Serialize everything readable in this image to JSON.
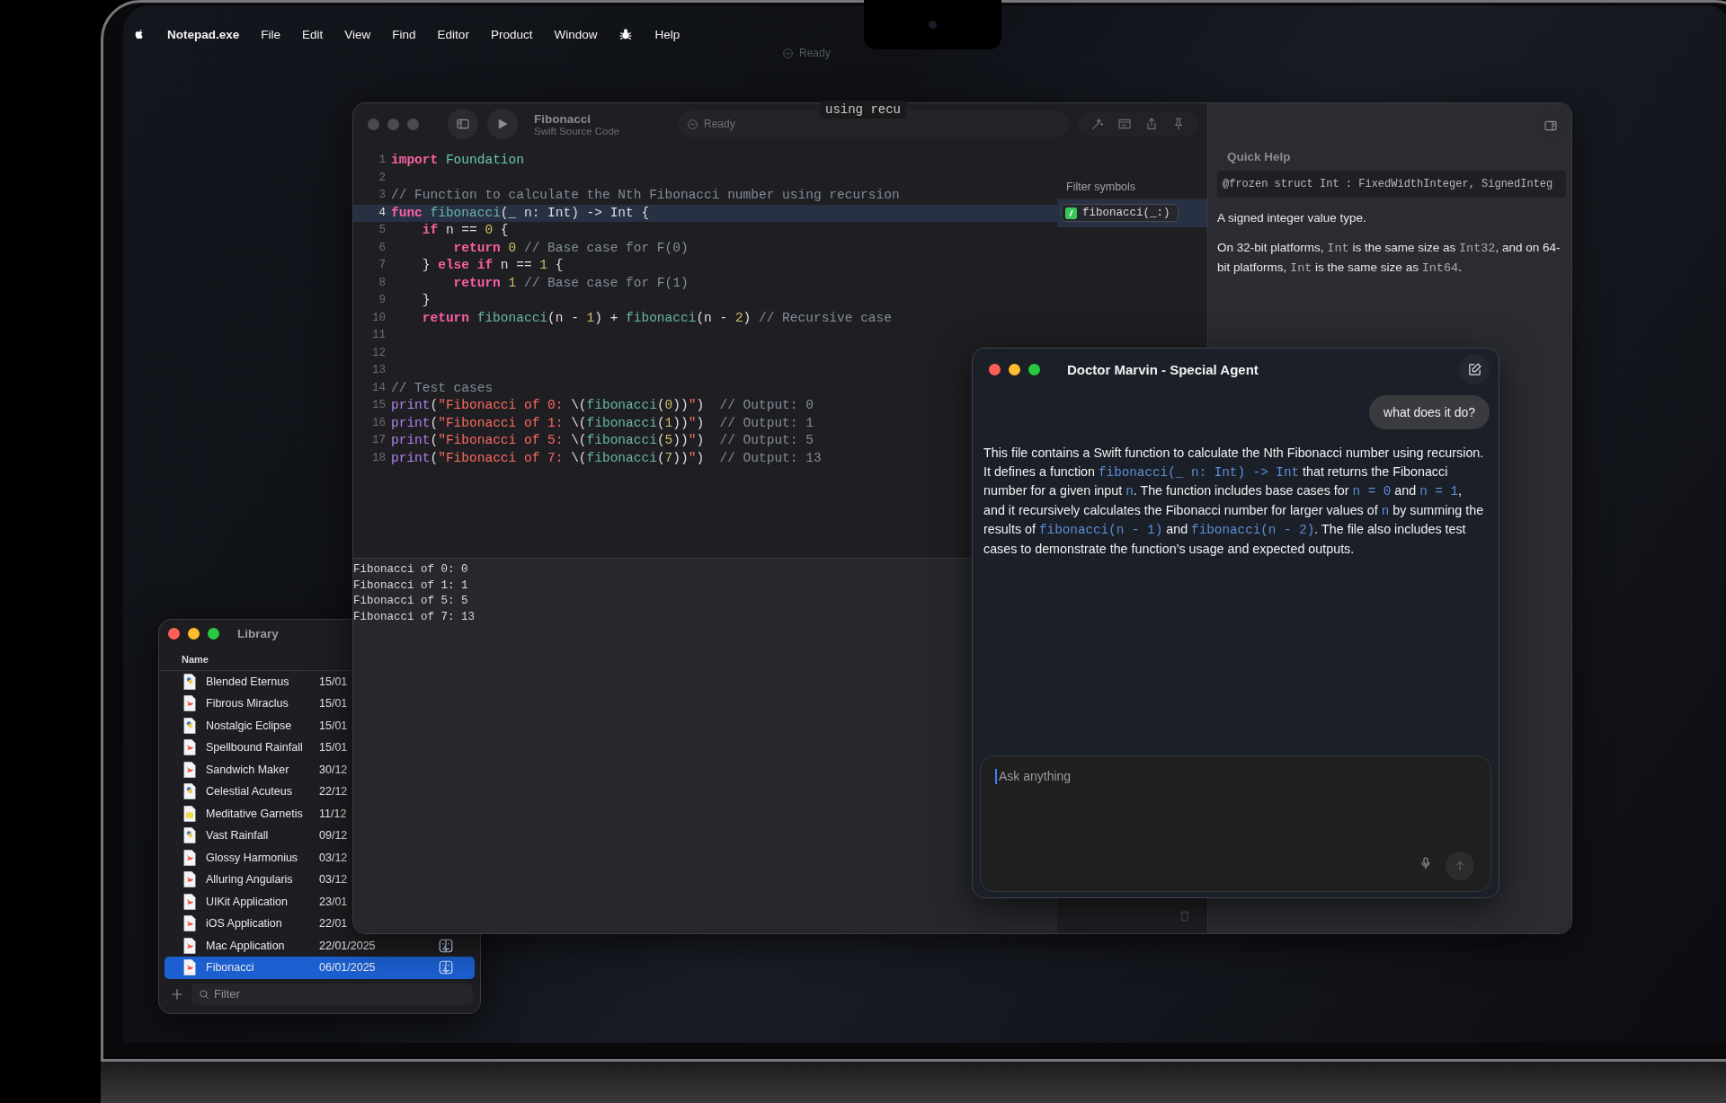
{
  "menu_bar": {
    "app_name": "Notepad.exe",
    "items": [
      "File",
      "Edit",
      "View",
      "Find",
      "Editor",
      "Product",
      "Window"
    ],
    "help": "Help"
  },
  "desktop_status": {
    "status": "Ready"
  },
  "editor_window": {
    "active": false,
    "title": "Fibonacci",
    "subtitle": "Swift Source Code",
    "status": "Ready",
    "tooltip": "using recu",
    "lines": [
      {
        "number": "1",
        "highlighted": false,
        "tokens": [
          {
            "kind": "keyword",
            "text": "import"
          },
          {
            "kind": "type",
            "text": " Foundation"
          }
        ]
      },
      {
        "number": "2",
        "highlighted": false
      },
      {
        "number": "3",
        "highlighted": false,
        "tokens": [
          {
            "kind": "comment",
            "text": "// Function to calculate the Nth Fibonacci number using recursion"
          }
        ]
      },
      {
        "number": "4",
        "highlighted": true,
        "tokens": [
          {
            "kind": "keyword",
            "text": "func"
          },
          {
            "kind": "func",
            "text": " fibonacci"
          },
          {
            "kind": "plain",
            "text": "(_ n: Int) -> Int {"
          }
        ]
      },
      {
        "number": "5",
        "highlighted": false,
        "tokens": [
          {
            "kind": "keyword",
            "text": "    if"
          },
          {
            "kind": "plain",
            "text": " n == "
          },
          {
            "kind": "number",
            "text": "0"
          },
          {
            "kind": "plain",
            "text": " {"
          }
        ]
      },
      {
        "number": "6",
        "highlighted": false,
        "tokens": [
          {
            "kind": "keyword",
            "text": "        return"
          },
          {
            "kind": "number",
            "text": " 0"
          },
          {
            "kind": "comment",
            "text": " // Base case for F(0)"
          }
        ]
      },
      {
        "number": "7",
        "highlighted": false,
        "tokens": [
          {
            "kind": "plain",
            "text": "    } "
          },
          {
            "kind": "keyword",
            "text": "else if"
          },
          {
            "kind": "plain",
            "text": " n == "
          },
          {
            "kind": "number",
            "text": "1"
          },
          {
            "kind": "plain",
            "text": " {"
          }
        ]
      },
      {
        "number": "8",
        "highlighted": false,
        "tokens": [
          {
            "kind": "keyword",
            "text": "        return"
          },
          {
            "kind": "number",
            "text": " 1"
          },
          {
            "kind": "comment",
            "text": " // Base case for F(1)"
          }
        ]
      },
      {
        "number": "9",
        "highlighted": false,
        "tokens": [
          {
            "kind": "plain",
            "text": "    }"
          }
        ]
      },
      {
        "number": "10",
        "highlighted": false,
        "tokens": [
          {
            "kind": "keyword",
            "text": "    return"
          },
          {
            "kind": "func",
            "text": " fibonacci"
          },
          {
            "kind": "plain",
            "text": "(n - "
          },
          {
            "kind": "number",
            "text": "1"
          },
          {
            "kind": "plain",
            "text": ") + "
          },
          {
            "kind": "func",
            "text": "fibonacci"
          },
          {
            "kind": "plain",
            "text": "(n - "
          },
          {
            "kind": "number",
            "text": "2"
          },
          {
            "kind": "plain",
            "text": ")"
          },
          {
            "kind": "comment",
            "text": " // Recursive case"
          }
        ]
      },
      {
        "number": "11",
        "highlighted": false
      },
      {
        "number": "12",
        "highlighted": false
      },
      {
        "number": "13",
        "highlighted": false
      },
      {
        "number": "14",
        "highlighted": false,
        "tokens": [
          {
            "kind": "comment",
            "text": "// Test cases"
          }
        ]
      },
      {
        "number": "15",
        "highlighted": false,
        "tokens": [
          {
            "kind": "print",
            "text": "print"
          },
          {
            "kind": "plain",
            "text": "("
          },
          {
            "kind": "string",
            "text": "\"Fibonacci of 0: "
          },
          {
            "kind": "plain",
            "text": "\\("
          },
          {
            "kind": "func",
            "text": "fibonacci"
          },
          {
            "kind": "plain",
            "text": "("
          },
          {
            "kind": "number",
            "text": "0"
          },
          {
            "kind": "plain",
            "text": "))"
          },
          {
            "kind": "string",
            "text": "\""
          },
          {
            "kind": "plain",
            "text": ")"
          },
          {
            "kind": "comment",
            "text": "  // Output: 0"
          }
        ]
      },
      {
        "number": "16",
        "highlighted": false,
        "tokens": [
          {
            "kind": "print",
            "text": "print"
          },
          {
            "kind": "plain",
            "text": "("
          },
          {
            "kind": "string",
            "text": "\"Fibonacci of 1: "
          },
          {
            "kind": "plain",
            "text": "\\("
          },
          {
            "kind": "func",
            "text": "fibonacci"
          },
          {
            "kind": "plain",
            "text": "("
          },
          {
            "kind": "number",
            "text": "1"
          },
          {
            "kind": "plain",
            "text": "))"
          },
          {
            "kind": "string",
            "text": "\""
          },
          {
            "kind": "plain",
            "text": ")"
          },
          {
            "kind": "comment",
            "text": "  // Output: 1"
          }
        ]
      },
      {
        "number": "17",
        "highlighted": false,
        "tokens": [
          {
            "kind": "print",
            "text": "print"
          },
          {
            "kind": "plain",
            "text": "("
          },
          {
            "kind": "string",
            "text": "\"Fibonacci of 5: "
          },
          {
            "kind": "plain",
            "text": "\\("
          },
          {
            "kind": "func",
            "text": "fibonacci"
          },
          {
            "kind": "plain",
            "text": "("
          },
          {
            "kind": "number",
            "text": "5"
          },
          {
            "kind": "plain",
            "text": "))"
          },
          {
            "kind": "string",
            "text": "\""
          },
          {
            "kind": "plain",
            "text": ")"
          },
          {
            "kind": "comment",
            "text": "  // Output: 5"
          }
        ]
      },
      {
        "number": "18",
        "highlighted": false,
        "tokens": [
          {
            "kind": "print",
            "text": "print"
          },
          {
            "kind": "plain",
            "text": "("
          },
          {
            "kind": "string",
            "text": "\"Fibonacci of 7: "
          },
          {
            "kind": "plain",
            "text": "\\("
          },
          {
            "kind": "func",
            "text": "fibonacci"
          },
          {
            "kind": "plain",
            "text": "("
          },
          {
            "kind": "number",
            "text": "7"
          },
          {
            "kind": "plain",
            "text": "))"
          },
          {
            "kind": "string",
            "text": "\""
          },
          {
            "kind": "plain",
            "text": ")"
          },
          {
            "kind": "comment",
            "text": "  // Output: 13"
          }
        ]
      }
    ],
    "output": [
      "Fibonacci of 0: 0",
      "Fibonacci of 1: 1",
      "Fibonacci of 5: 5",
      "Fibonacci of 7: 13"
    ],
    "symbols": {
      "label": "Filter symbols",
      "items": [
        {
          "name": "fibonacci(_:)",
          "selected": true
        }
      ]
    },
    "quick_help": {
      "title": "Quick Help",
      "declaration": "@frozen struct Int : FixedWidthInteger, SignedInteg",
      "paragraphs": [
        [
          {
            "kind": "text",
            "text": "A signed integer value type."
          }
        ],
        [
          {
            "kind": "text",
            "text": "On 32-bit platforms, "
          },
          {
            "kind": "code",
            "text": "Int"
          },
          {
            "kind": "text",
            "text": " is the same size as "
          },
          {
            "kind": "code",
            "text": "Int32"
          },
          {
            "kind": "text",
            "text": ", and on 64-bit platforms, "
          },
          {
            "kind": "code",
            "text": "Int"
          },
          {
            "kind": "text",
            "text": " is the same size as "
          },
          {
            "kind": "code",
            "text": "Int64"
          },
          {
            "kind": "text",
            "text": "."
          }
        ]
      ]
    }
  },
  "library_window": {
    "active": true,
    "title": "Library",
    "column": "Name",
    "rows": [
      {
        "name": "Blended Eternus",
        "date": "15/01",
        "kind": "python",
        "selected": false
      },
      {
        "name": "Fibrous Miraclus",
        "date": "15/01",
        "kind": "swift",
        "selected": false
      },
      {
        "name": "Nostalgic Eclipse",
        "date": "15/01",
        "kind": "python",
        "selected": false
      },
      {
        "name": "Spellbound Rainfall",
        "date": "15/01",
        "kind": "swift",
        "selected": false
      },
      {
        "name": "Sandwich Maker",
        "date": "30/12",
        "kind": "swift",
        "selected": false
      },
      {
        "name": "Celestial Acuteus",
        "date": "22/12",
        "kind": "python",
        "selected": false
      },
      {
        "name": "Meditative Garnetis",
        "date": "11/12",
        "kind": "javascript",
        "selected": false
      },
      {
        "name": "Vast Rainfall",
        "date": "09/12",
        "kind": "python",
        "selected": false
      },
      {
        "name": "Glossy Harmonius",
        "date": "03/12",
        "kind": "swift",
        "selected": false
      },
      {
        "name": "Alluring Angularis",
        "date": "03/12",
        "kind": "swift",
        "selected": false
      },
      {
        "name": "UIKit Application",
        "date": "23/01",
        "kind": "swift",
        "selected": false
      },
      {
        "name": "iOS Application",
        "date": "22/01",
        "kind": "swift",
        "selected": false
      },
      {
        "name": "Mac Application",
        "date": "22/01/2025",
        "kind": "swift",
        "app_icon": true,
        "selected": false
      },
      {
        "name": "Fibonacci",
        "date": "06/01/2025",
        "kind": "swift",
        "app_icon": true,
        "selected": true
      }
    ],
    "filter": {
      "placeholder": "Filter"
    }
  },
  "agent_window": {
    "active": true,
    "title": "Doctor Marvin - Special Agent",
    "user_message": "what does it do?",
    "reply": [
      {
        "kind": "text",
        "text": "This file contains a Swift function to calculate the Nth Fibonacci number using recursion. It defines a function "
      },
      {
        "kind": "code",
        "text": "fibonacci(_ n: Int) -> Int"
      },
      {
        "kind": "text",
        "text": " that returns the Fibonacci number for a given input "
      },
      {
        "kind": "code",
        "text": "n"
      },
      {
        "kind": "text",
        "text": ". The function includes base cases for "
      },
      {
        "kind": "code",
        "text": "n = 0"
      },
      {
        "kind": "text",
        "text": " and "
      },
      {
        "kind": "code",
        "text": "n = 1"
      },
      {
        "kind": "text",
        "text": ", and it recursively calculates the Fibonacci number for larger values of "
      },
      {
        "kind": "code",
        "text": "n"
      },
      {
        "kind": "text",
        "text": " by summing the results of "
      },
      {
        "kind": "code",
        "text": "fibonacci(n - 1)"
      },
      {
        "kind": "text",
        "text": " and "
      },
      {
        "kind": "code",
        "text": "fibonacci(n - 2)"
      },
      {
        "kind": "text",
        "text": ". The file also includes test cases to demonstrate the function’s usage and expected outputs."
      }
    ],
    "input": {
      "placeholder": "Ask anything"
    }
  }
}
